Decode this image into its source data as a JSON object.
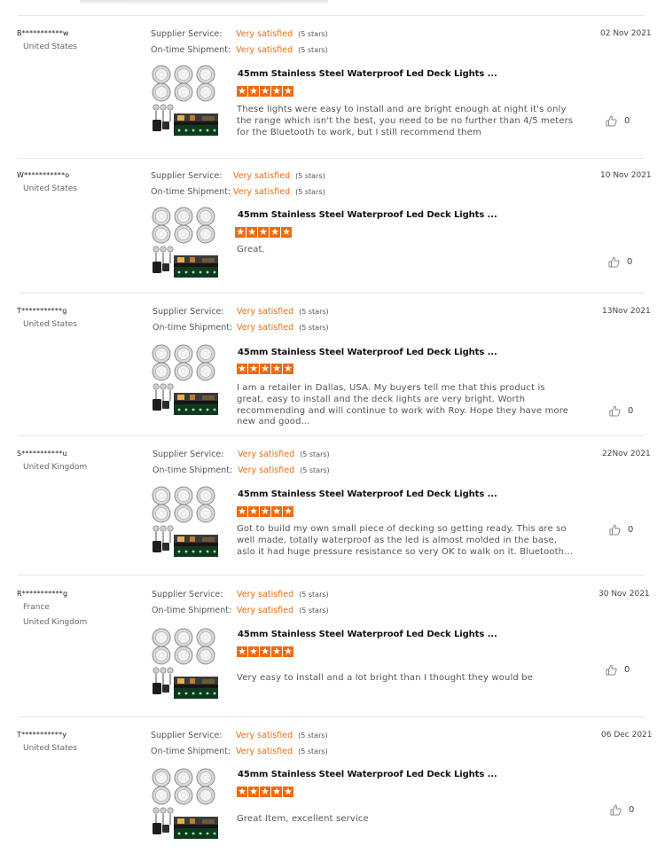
{
  "labels": {
    "supplier_service": "Supplier Service:",
    "ontime_shipment": "On-time Shipment:"
  },
  "reviews": [
    {
      "user": "B***********w",
      "countries": [
        "United States"
      ],
      "supplier_rating": "Very satisfied",
      "supplier_stars": "(5 stars)",
      "shipment_rating": "Very satisfied",
      "shipment_stars": "(5 stars)",
      "date": "02 Nov 2021",
      "product_title": "45mm Stainless Steel Waterproof Led Deck Lights ...",
      "stars": 5,
      "text": "These lights were easy to install and are bright enough at night it's only the range which isn't the best, you need to be no further than 4/5 meters for the Bluetooth to work, but I still recommend them",
      "likes": "0"
    },
    {
      "user": "W***********o",
      "countries": [
        "United States"
      ],
      "supplier_rating": "Very satisfied",
      "supplier_stars": "(5 stars)",
      "shipment_rating": "Very satisfied",
      "shipment_stars": "(5 stars)",
      "date": "10 Nov 2021",
      "product_title": "45mm Stainless Steel Waterproof Led Deck Lights ...",
      "stars": 5,
      "text": "Great.",
      "likes": "0"
    },
    {
      "user": "T***********g",
      "countries": [
        "United States"
      ],
      "supplier_rating": "Very satisfied",
      "supplier_stars": "(5 stars)",
      "shipment_rating": "Very satisfied",
      "shipment_stars": "(5 stars)",
      "date": "13Nov 2021",
      "product_title": "45mm Stainless Steel Waterproof Led Deck Lights ...",
      "stars": 5,
      "text": "I am a retailer in Dallas, USA. My buyers tell me that this product is great, easy to install and the deck lights are very bright. Worth recommending and will continue to work with Roy. Hope they have more new and good...",
      "likes": "0"
    },
    {
      "user": "S***********u",
      "countries": [
        "United Kingdom"
      ],
      "supplier_rating": "Very satisfied",
      "supplier_stars": "(5 stars)",
      "shipment_rating": "Very satisfied",
      "shipment_stars": "(5 stars)",
      "date": "22Nov 2021",
      "product_title": "45mm Stainless Steel Waterproof Led Deck Lights ...",
      "stars": 5,
      "text": "Got to build my own small piece of decking so getting ready. This are so well made, totally waterproof as the led is almost molded in the base, aslo it had huge pressure resistance so very OK to walk on it. Bluetooth...",
      "likes": "0"
    },
    {
      "user": "R***********g",
      "countries": [
        "France",
        "United Kingdom"
      ],
      "supplier_rating": "Very satisfied",
      "supplier_stars": "(5 stars)",
      "shipment_rating": "Very satisfied",
      "shipment_stars": "(5 stars)",
      "date": "30 Nov 2021",
      "product_title": "45mm Stainless Steel Waterproof Led Deck Lights ...",
      "stars": 5,
      "text": "Very easy to install and a lot bright than I thought they would be",
      "likes": "0"
    },
    {
      "user": "T***********y",
      "countries": [
        "United States"
      ],
      "supplier_rating": "Very satisfied",
      "supplier_stars": "(5 stars)",
      "shipment_rating": "Very satisfied",
      "shipment_stars": "(5 stars)",
      "date": "06 Dec 2021",
      "product_title": "45mm Stainless Steel Waterproof Led Deck Lights ...",
      "stars": 5,
      "text": "Great Item, excellent service",
      "likes": "0"
    }
  ],
  "colors": {
    "accent": "#f06a0f",
    "separator": "#e6e6e6"
  },
  "icons": {
    "star": "star-icon",
    "like": "thumbs-up-icon"
  }
}
